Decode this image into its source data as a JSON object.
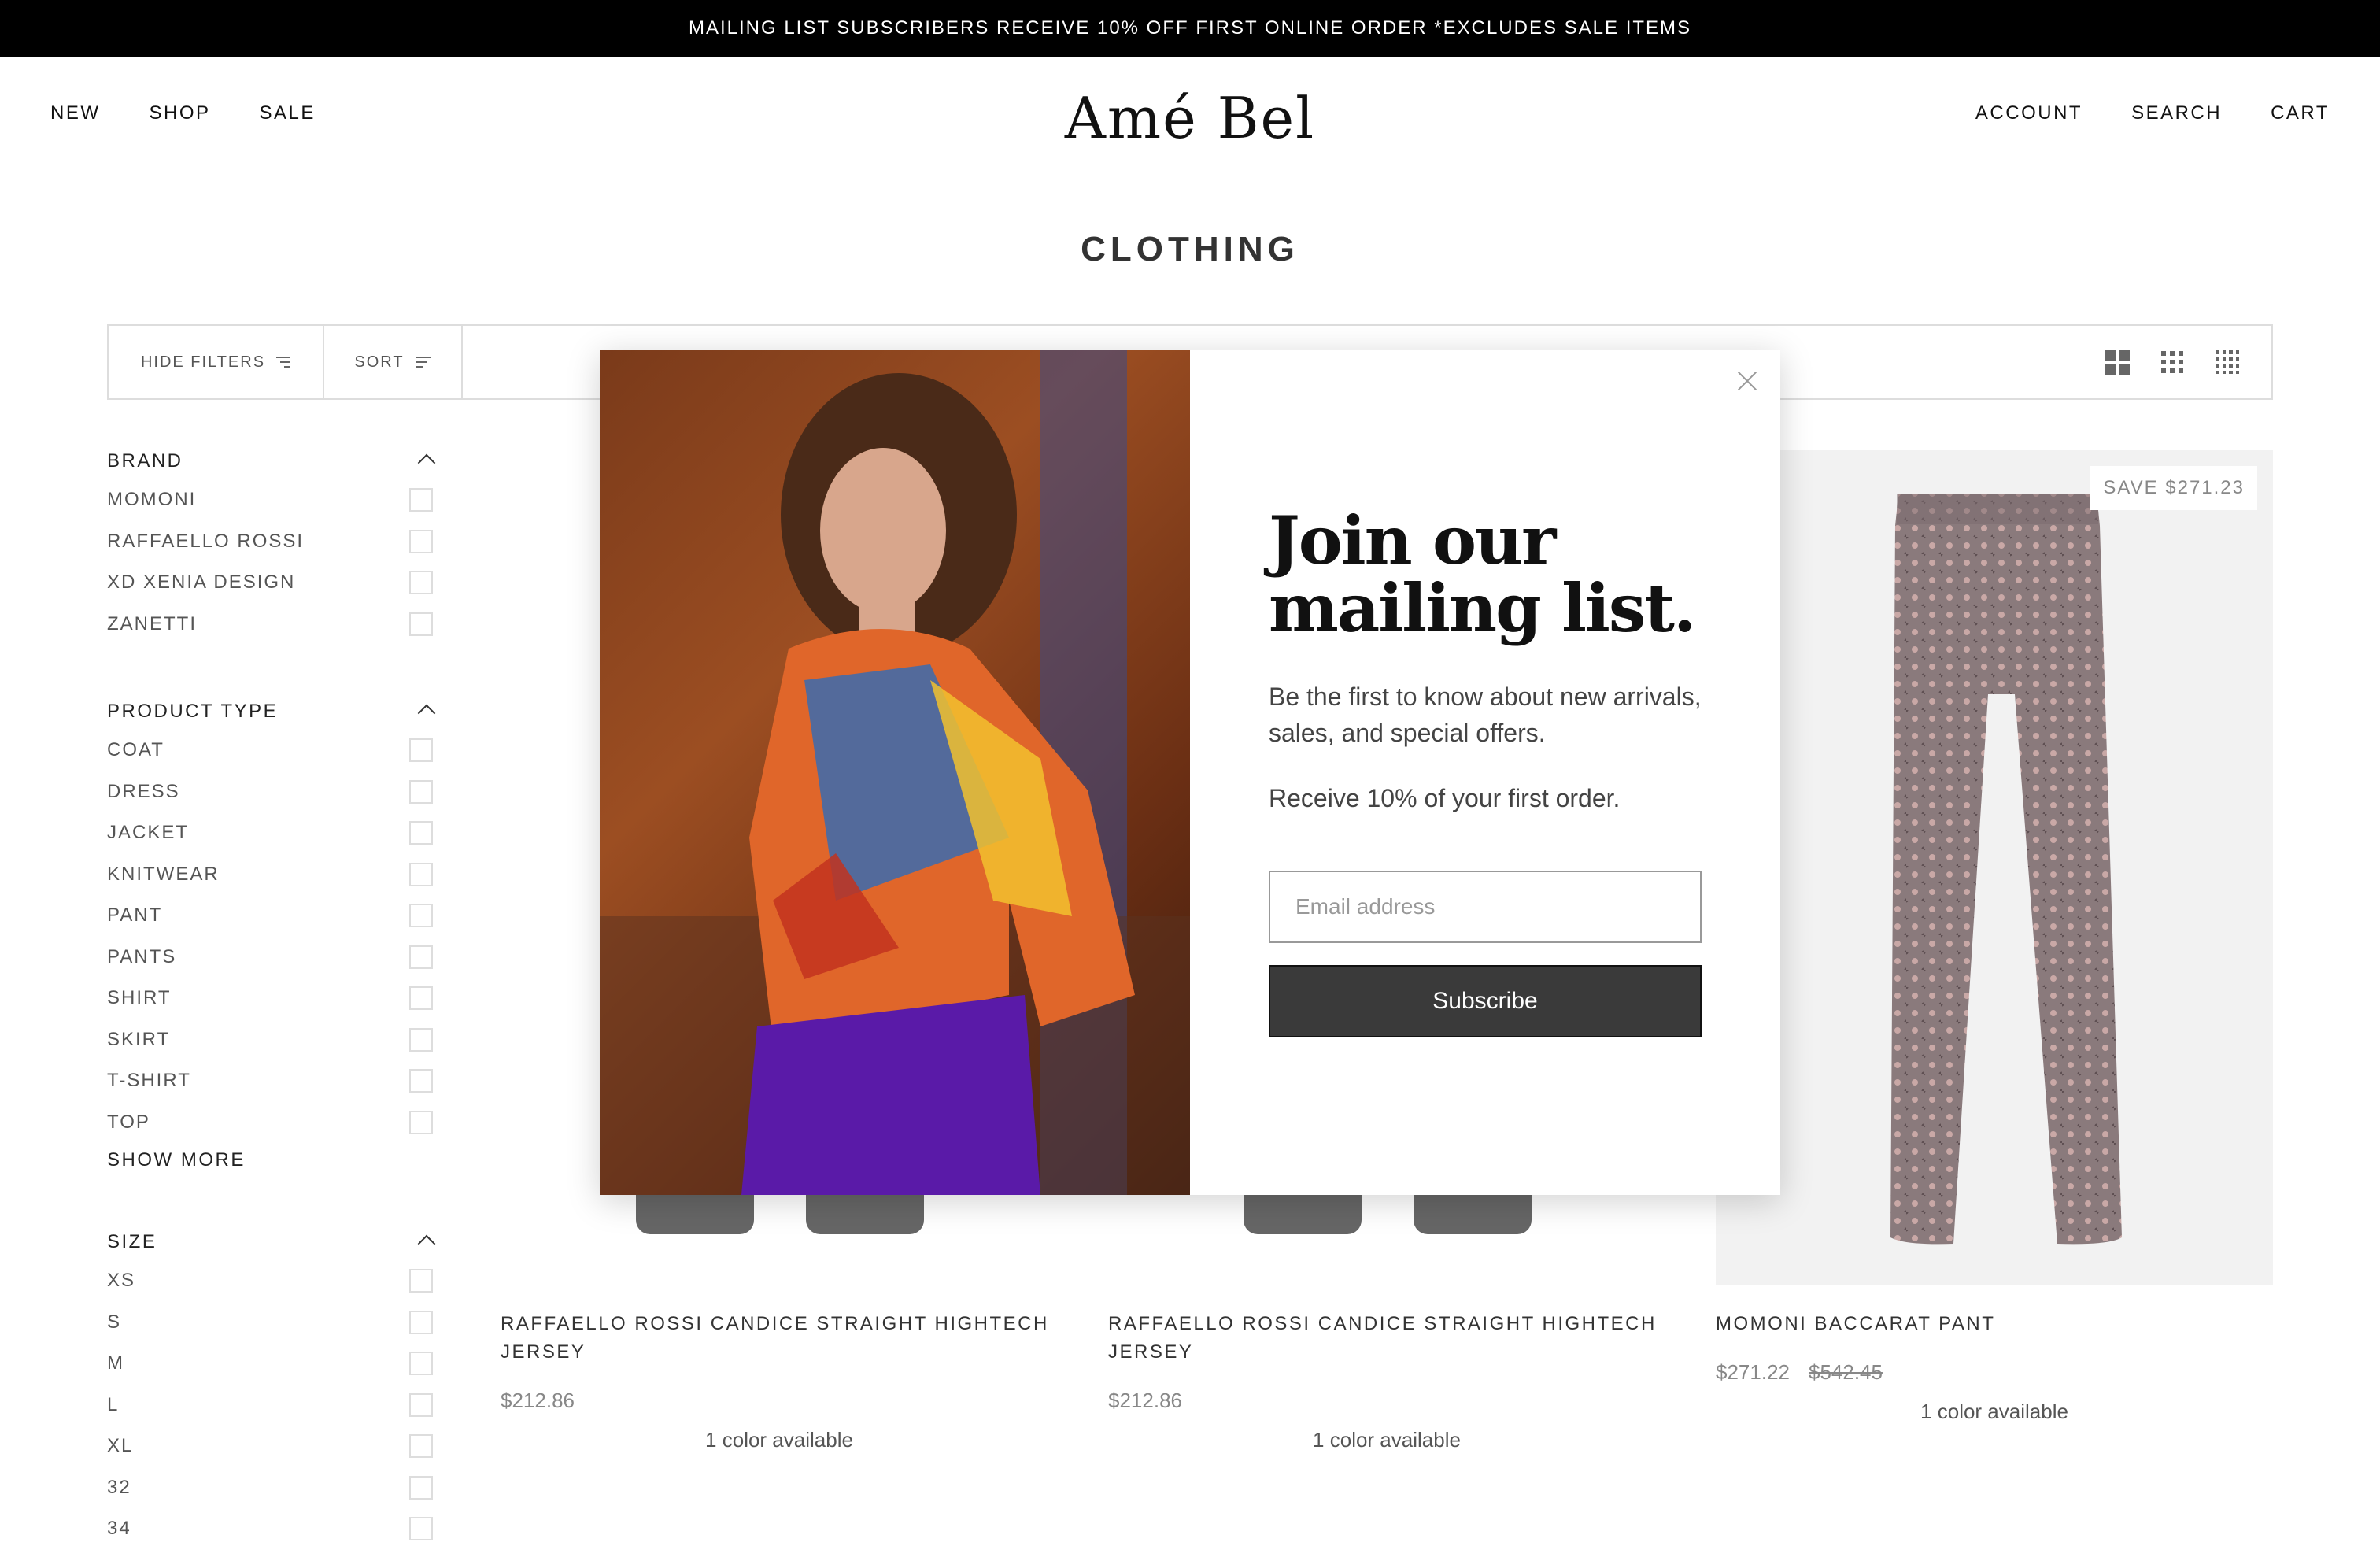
{
  "announcement": "MAILING LIST SUBSCRIBERS RECEIVE 10% OFF FIRST ONLINE ORDER *EXCLUDES SALE ITEMS",
  "header": {
    "logo": "Amé Bel",
    "nav_left": [
      "NEW",
      "SHOP",
      "SALE"
    ],
    "nav_right": [
      "ACCOUNT",
      "SEARCH",
      "CART"
    ]
  },
  "page_title": "CLOTHING",
  "toolbar": {
    "hide_filters_label": "HIDE FILTERS",
    "sort_label": "SORT",
    "grid_options": [
      "grid-2-icon",
      "grid-3-icon",
      "grid-4-icon"
    ]
  },
  "filters": {
    "brand": {
      "title": "BRAND",
      "options": [
        "MOMONI",
        "RAFFAELLO ROSSI",
        "XD XENIA DESIGN",
        "ZANETTI"
      ]
    },
    "product_type": {
      "title": "PRODUCT TYPE",
      "options": [
        "COAT",
        "DRESS",
        "JACKET",
        "KNITWEAR",
        "PANT",
        "PANTS",
        "SHIRT",
        "SKIRT",
        "T-SHIRT",
        "TOP"
      ],
      "show_more": "SHOW MORE"
    },
    "size": {
      "title": "SIZE",
      "options": [
        "XS",
        "S",
        "M",
        "L",
        "XL",
        "32",
        "34"
      ]
    }
  },
  "products": [
    {
      "name": "RAFFAELLO ROSSI CANDICE STRAIGHT HIGHTECH JERSEY",
      "price": "$212.86",
      "colors": "1 color available"
    },
    {
      "name": "RAFFAELLO ROSSI CANDICE STRAIGHT HIGHTECH JERSEY",
      "price": "$212.86",
      "colors": "1 color available"
    },
    {
      "name": "MOMONI BACCARAT PANT",
      "price": "$271.22",
      "compare_price": "$542.45",
      "badge": "SAVE $271.23",
      "colors": "1 color available"
    }
  ],
  "modal": {
    "title": "Join our mailing list.",
    "subtitle": "Be the first to know about new arrivals, sales, and special offers.",
    "offer": "Receive 10% of your first order.",
    "email_placeholder": "Email address",
    "subscribe_label": "Subscribe"
  },
  "colors": {
    "announcement_bg": "#000000",
    "button_bg": "#3a3a3a",
    "product_bg": "#f2f2f2"
  }
}
